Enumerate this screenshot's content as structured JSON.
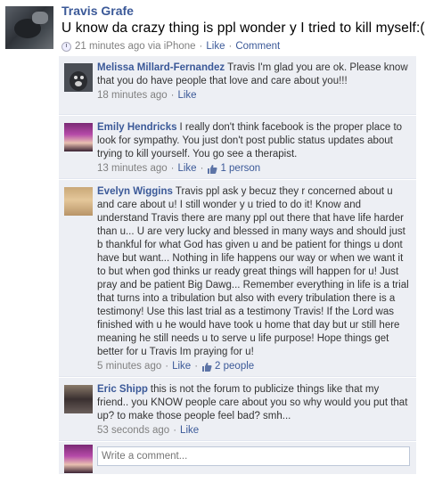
{
  "story": {
    "author": "Travis Grafe",
    "status": "U know da crazy thing is ppl wonder y I tried to kill myself:(",
    "time": "21 minutes ago via iPhone",
    "like_label": "Like",
    "comment_label": "Comment"
  },
  "comments": [
    {
      "name": "Melissa Millard-Fernandez",
      "text": "Travis I'm glad you are ok. Please know that you do have people that love and care about you!!!",
      "time": "18 minutes ago",
      "like_label": "Like",
      "likes": ""
    },
    {
      "name": "Emily Hendricks",
      "text": "I really don't think facebook is the proper place to look for sympathy. You just don't post public status updates about trying to kill yourself. You go see a therapist.",
      "time": "13 minutes ago",
      "like_label": "Like",
      "likes": "1 person"
    },
    {
      "name": "Evelyn Wiggins",
      "text": "Travis ppl ask y becuz they r concerned about u and care about u! I still wonder y u tried to do it! Know and understand Travis there are many ppl out there that have life harder than u... U are very lucky and blessed in many ways and should just b thankful for what God has given u and be patient for things u dont have but want... Nothing in life happens our way or when we want it to but when god thinks ur ready great things will happen for u! Just pray and be patient Big Dawg... Remember everything in life is a trial that turns into a tribulation but also with every tribulation there is a testimony! Use this last trial as a testimony Travis! If the Lord was finished with u he would have took u home that day but ur still here meaning he still needs u to serve u life purpose! Hope things get better for u Travis Im praying for u!",
      "time": "5 minutes ago",
      "like_label": "Like",
      "likes": "2 people"
    },
    {
      "name": "Eric Shipp",
      "text": "this is not the forum to publicize things like that my friend.. you KNOW people care about you so why would you put that up? to make those people feel bad? smh...",
      "time": "53 seconds ago",
      "like_label": "Like",
      "likes": ""
    }
  ],
  "write_comment": {
    "placeholder": "Write a comment..."
  },
  "colors": {
    "link": "#3b5998",
    "comment_bg": "#edeff4",
    "meta": "#808080"
  },
  "icons": [
    "clock-icon",
    "thumbs-up-icon"
  ]
}
